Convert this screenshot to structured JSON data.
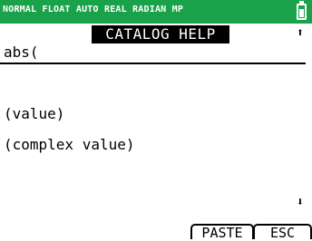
{
  "status_bar": {
    "text": "NORMAL FLOAT AUTO REAL RADIAN MP",
    "battery_icon": "battery-icon"
  },
  "header": {
    "title": "CATALOG HELP",
    "scroll_up_icon": "up-arrow-icon"
  },
  "command": {
    "name": "abs("
  },
  "syntax_list": [
    "(value)",
    "(complex value)"
  ],
  "footer": {
    "scroll_down_icon": "down-arrow-icon",
    "softkeys": [
      "PASTE",
      "ESC"
    ]
  },
  "colors": {
    "status_bar_bg": "#1aa24a",
    "title_bg": "#000000",
    "screen_bg": "#ffffff"
  }
}
